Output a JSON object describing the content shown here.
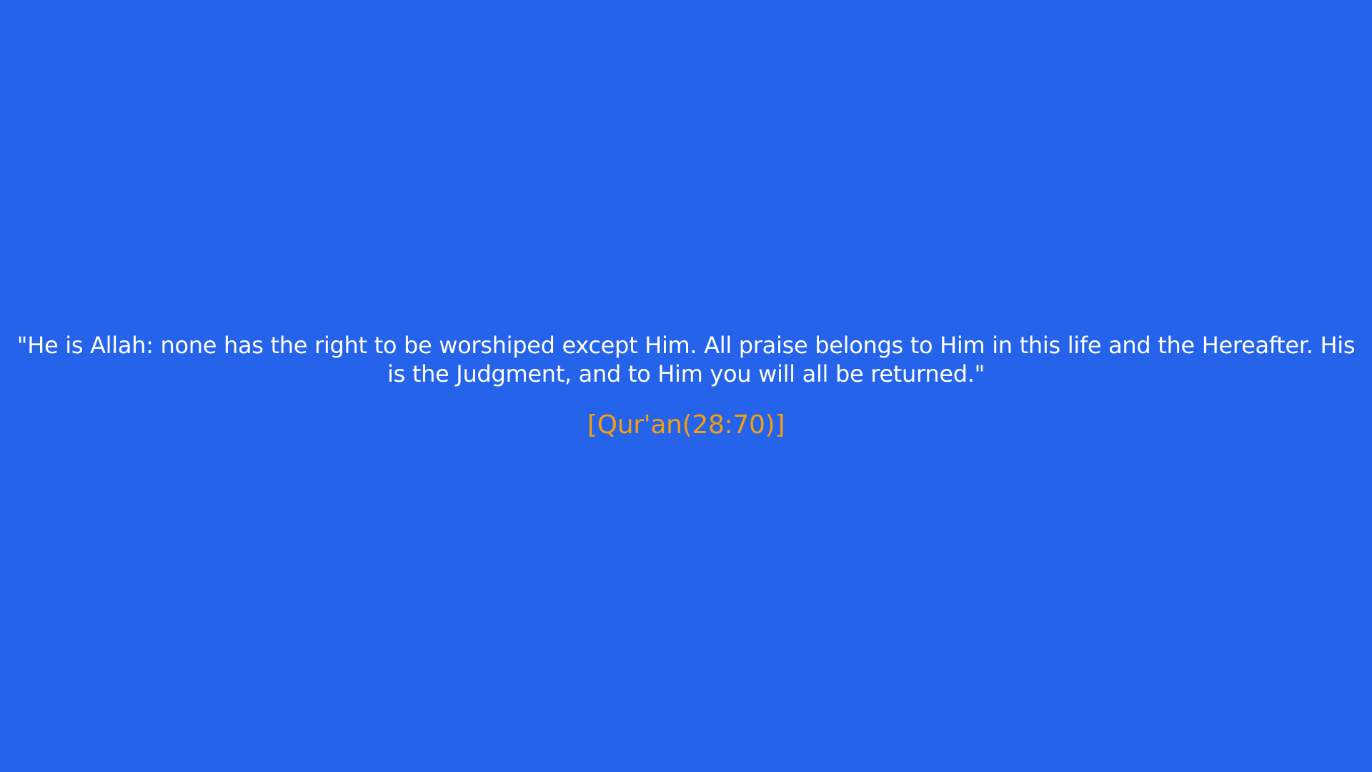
{
  "quote": {
    "text": "\"He is Allah: none has the right to be worshiped except Him. All praise belongs to Him in this life and the Hereafter. His is the Judgment, and to Him you will all be returned.\""
  },
  "citation": {
    "text": "[Qur'an(28:70)]"
  },
  "colors": {
    "background": "#2563EB",
    "quote_text": "#FFFFFF",
    "citation_text": "#F59E0B"
  }
}
